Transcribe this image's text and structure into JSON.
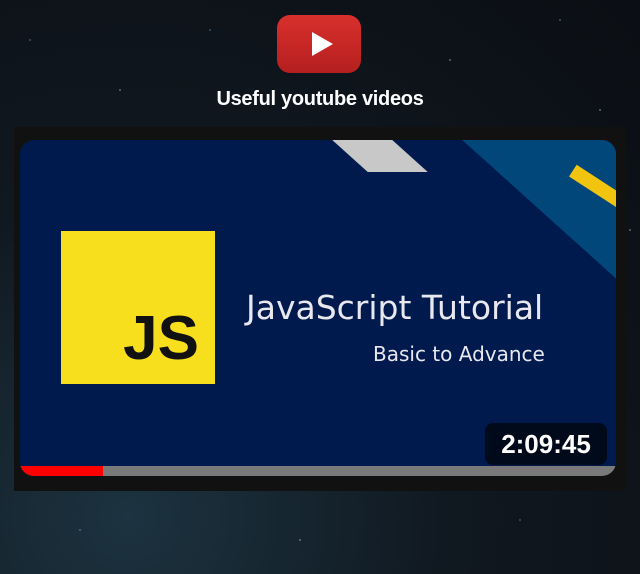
{
  "header": {
    "logo_icon": "youtube-play-icon",
    "title": "Useful youtube videos"
  },
  "video": {
    "thumbnail_title": "JavaScript Tutorial",
    "thumbnail_subtitle": "Basic to Advance",
    "logo_text": "JS",
    "duration": "2:09:45",
    "progress_percent": 14,
    "colors": {
      "progress": "#ff0000",
      "background": "#001a4e",
      "js_yellow": "#f7df1e"
    }
  }
}
